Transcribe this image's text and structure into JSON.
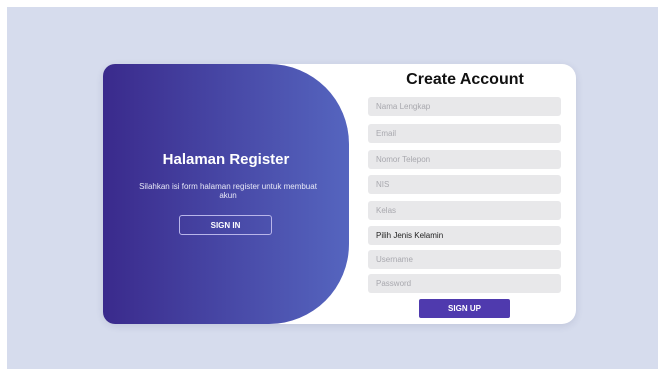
{
  "left_panel": {
    "title": "Halaman Register",
    "subtitle": "Silahkan isi form halaman register untuk membuat akun",
    "signin_label": "SIGN IN"
  },
  "form": {
    "title": "Create Account",
    "fields": {
      "nama": "Nama Lengkap",
      "email": "Email",
      "telepon": "Nomor Telepon",
      "nis": "NIS",
      "kelas": "Kelas",
      "username": "Username",
      "password": "Password"
    },
    "gender_select": "Pilih Jenis Kelamin",
    "signup_label": "SIGN UP"
  },
  "colors": {
    "backdrop": "#d6dced",
    "panel_gradient_start": "#3a2a8c",
    "panel_gradient_end": "#5565bf",
    "signup_button": "#4f3aae",
    "field_bg": "#e8e8ea"
  }
}
